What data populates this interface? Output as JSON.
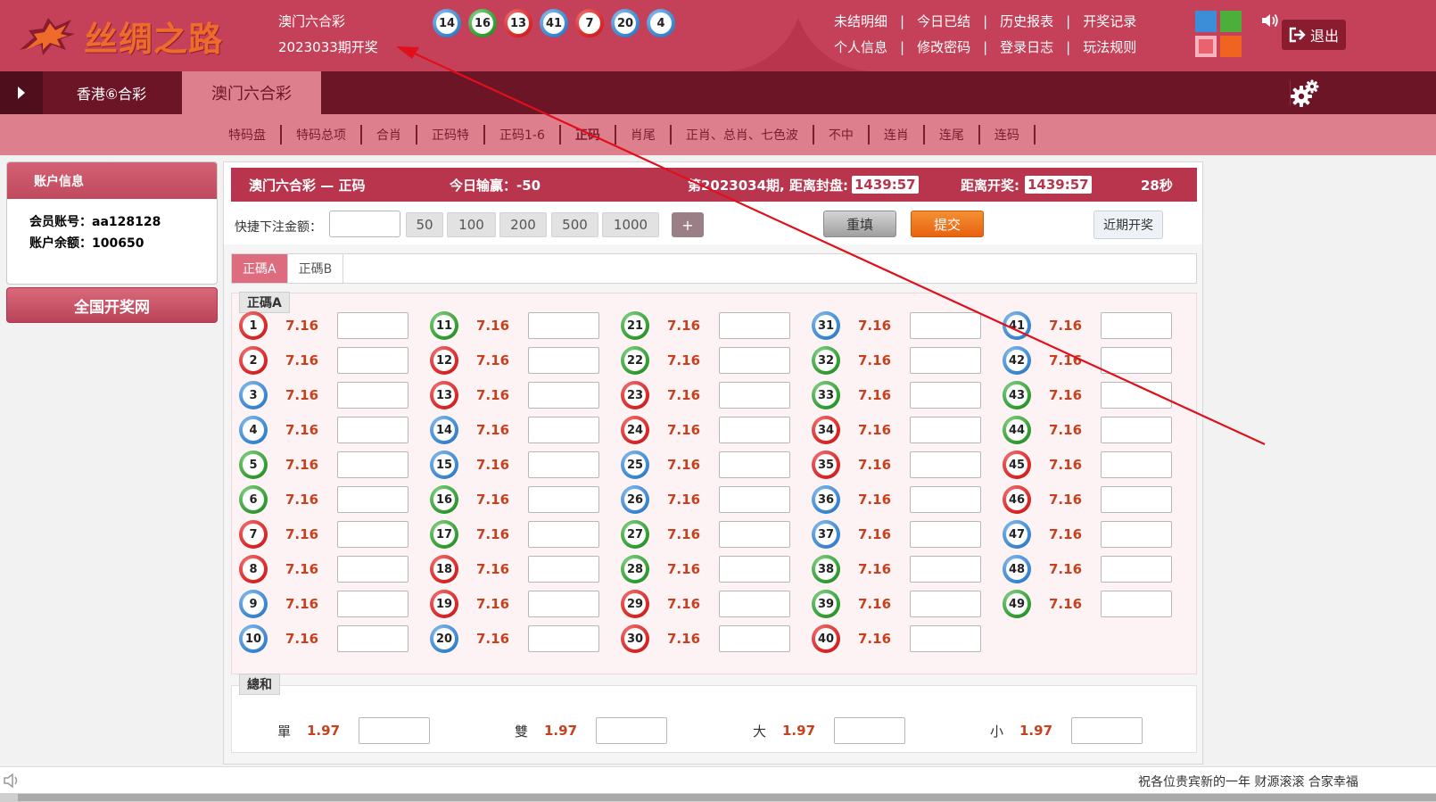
{
  "header": {
    "logo_text": "丝绸之路",
    "game_name": "澳门六合彩",
    "draw_period": "2023033期开奖",
    "draw_balls": [
      {
        "num": "14",
        "color": "blue"
      },
      {
        "num": "16",
        "color": "green"
      },
      {
        "num": "13",
        "color": "red"
      },
      {
        "num": "41",
        "color": "blue"
      },
      {
        "num": "7",
        "color": "red"
      },
      {
        "num": "20",
        "color": "blue"
      },
      {
        "num": "4",
        "color": "blue"
      }
    ],
    "links_row1": [
      "未结明细",
      "今日已结",
      "历史报表",
      "开奖记录"
    ],
    "links_row2": [
      "个人信息",
      "修改密码",
      "登录日志",
      "玩法规则"
    ],
    "link_sep": "|",
    "swatch_colors": [
      "#3d8ed9",
      "#4caf3c",
      "#e8626f",
      "#ef6420"
    ],
    "logout_label": "退出"
  },
  "nav": {
    "tabs": [
      "香港⑥合彩",
      "澳门六合彩"
    ],
    "active_index": 1
  },
  "subnav": {
    "items": [
      "特码盘",
      "特码总项",
      "合肖",
      "正码特",
      "正码1-6",
      "正码",
      "肖尾",
      "正肖、总肖、七色波",
      "不中",
      "连肖",
      "连尾",
      "连码"
    ],
    "active": "正码"
  },
  "account": {
    "title": "账户信息",
    "member_label": "会员账号：",
    "member_value": "aa128128",
    "balance_label": "账户余额：",
    "balance_value": "100650",
    "draw_site_button": "全国开奖网"
  },
  "main": {
    "title": "澳门六合彩 — 正码",
    "today_win_loss": "今日输赢：-50",
    "period_text": "第2023034期, 距离封盘:",
    "close_timer": "1439:57",
    "draw_label": "距离开奖:",
    "draw_timer": "1439:57",
    "seconds": "28秒"
  },
  "quickbar": {
    "label": "快捷下注金额：",
    "amounts": [
      "50",
      "100",
      "200",
      "500",
      "1000"
    ],
    "plus": "+",
    "reset": "重填",
    "submit": "提交",
    "recent": "近期开奖"
  },
  "subtabs": {
    "items": [
      "正碼A",
      "正碼B"
    ],
    "active_index": 0
  },
  "grid": {
    "section_label": "正碼A",
    "odds": "7.16",
    "numbers": [
      {
        "num": "1",
        "color": "red"
      },
      {
        "num": "2",
        "color": "red"
      },
      {
        "num": "3",
        "color": "blue"
      },
      {
        "num": "4",
        "color": "blue"
      },
      {
        "num": "5",
        "color": "green"
      },
      {
        "num": "6",
        "color": "green"
      },
      {
        "num": "7",
        "color": "red"
      },
      {
        "num": "8",
        "color": "red"
      },
      {
        "num": "9",
        "color": "blue"
      },
      {
        "num": "10",
        "color": "blue"
      },
      {
        "num": "11",
        "color": "green"
      },
      {
        "num": "12",
        "color": "red"
      },
      {
        "num": "13",
        "color": "red"
      },
      {
        "num": "14",
        "color": "blue"
      },
      {
        "num": "15",
        "color": "blue"
      },
      {
        "num": "16",
        "color": "green"
      },
      {
        "num": "17",
        "color": "green"
      },
      {
        "num": "18",
        "color": "red"
      },
      {
        "num": "19",
        "color": "red"
      },
      {
        "num": "20",
        "color": "blue"
      },
      {
        "num": "21",
        "color": "green"
      },
      {
        "num": "22",
        "color": "green"
      },
      {
        "num": "23",
        "color": "red"
      },
      {
        "num": "24",
        "color": "red"
      },
      {
        "num": "25",
        "color": "blue"
      },
      {
        "num": "26",
        "color": "blue"
      },
      {
        "num": "27",
        "color": "green"
      },
      {
        "num": "28",
        "color": "green"
      },
      {
        "num": "29",
        "color": "red"
      },
      {
        "num": "30",
        "color": "red"
      },
      {
        "num": "31",
        "color": "blue"
      },
      {
        "num": "32",
        "color": "green"
      },
      {
        "num": "33",
        "color": "green"
      },
      {
        "num": "34",
        "color": "red"
      },
      {
        "num": "35",
        "color": "red"
      },
      {
        "num": "36",
        "color": "blue"
      },
      {
        "num": "37",
        "color": "blue"
      },
      {
        "num": "38",
        "color": "green"
      },
      {
        "num": "39",
        "color": "green"
      },
      {
        "num": "40",
        "color": "red"
      },
      {
        "num": "41",
        "color": "blue"
      },
      {
        "num": "42",
        "color": "blue"
      },
      {
        "num": "43",
        "color": "green"
      },
      {
        "num": "44",
        "color": "green"
      },
      {
        "num": "45",
        "color": "red"
      },
      {
        "num": "46",
        "color": "red"
      },
      {
        "num": "47",
        "color": "blue"
      },
      {
        "num": "48",
        "color": "blue"
      },
      {
        "num": "49",
        "color": "green"
      }
    ]
  },
  "sum": {
    "section_label": "總和",
    "items": [
      {
        "label": "單",
        "odds": "1.97"
      },
      {
        "label": "雙",
        "odds": "1.97"
      },
      {
        "label": "大",
        "odds": "1.97"
      },
      {
        "label": "小",
        "odds": "1.97"
      }
    ]
  },
  "footer": {
    "marquee": "祝各位贵宾新的一年 财源滚滚 合家幸福"
  }
}
